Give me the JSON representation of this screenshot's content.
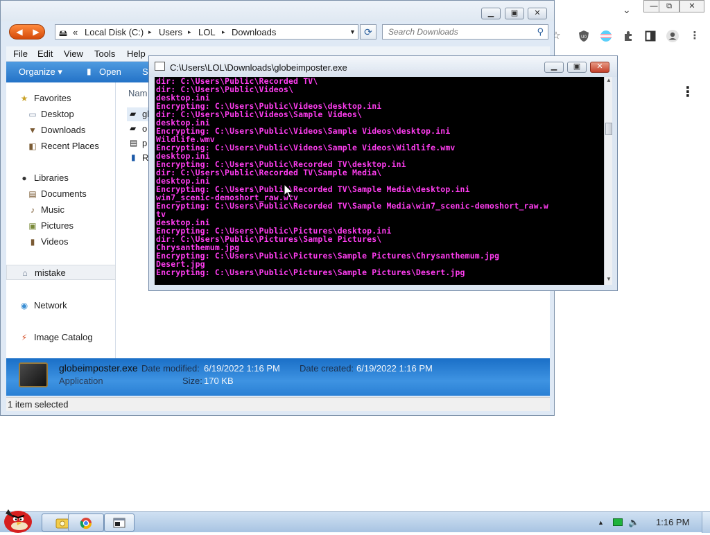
{
  "browser": {
    "chevron": "⌄",
    "minimize": "—",
    "restore": "⧉",
    "close": "✕",
    "toolbar_icons": [
      "star-icon",
      "ublock-icon",
      "flag-icon",
      "extensions-icon",
      "sidepanel-icon",
      "profile-icon",
      "menu-icon"
    ],
    "menu_dots": "⋮"
  },
  "explorer": {
    "address": {
      "chevrons": "«",
      "crumbs": [
        "Local Disk (C:)",
        "Users",
        "LOL",
        "Downloads"
      ],
      "separator": "▸"
    },
    "search_placeholder": "Search Downloads",
    "menu": [
      "File",
      "Edit",
      "View",
      "Tools",
      "Help"
    ],
    "toolbar": {
      "organize": "Organize ▾",
      "open": "Open",
      "share": "S"
    },
    "nav": {
      "favorites": "Favorites",
      "desktop": "Desktop",
      "downloads": "Downloads",
      "recent": "Recent Places",
      "libraries": "Libraries",
      "documents": "Documents",
      "music": "Music",
      "pictures": "Pictures",
      "videos": "Videos",
      "mistake": "mistake",
      "network": "Network",
      "image_catalog": "Image Catalog"
    },
    "file_header": "Nam",
    "file_rows": [
      "gl",
      "o",
      "p",
      "R"
    ],
    "details": {
      "name": "globeimposter.exe",
      "type": "Application",
      "date_modified_label": "Date modified:",
      "date_modified": "6/19/2022 1:16 PM",
      "date_created_label": "Date created:",
      "date_created": "6/19/2022 1:16 PM",
      "size_label": "Size:",
      "size": "170 KB"
    },
    "status": "1 item selected"
  },
  "console": {
    "title": "C:\\Users\\LOL\\Downloads\\globeimposter.exe",
    "text_color": "#ff3df0",
    "lines": [
      "dir: C:\\Users\\Public\\Recorded TV\\",
      "dir: C:\\Users\\Public\\Videos\\",
      "desktop.ini",
      "Encrypting: C:\\Users\\Public\\Videos\\desktop.ini",
      "dir: C:\\Users\\Public\\Videos\\Sample Videos\\",
      "desktop.ini",
      "Encrypting: C:\\Users\\Public\\Videos\\Sample Videos\\desktop.ini",
      "Wildlife.wmv",
      "Encrypting: C:\\Users\\Public\\Videos\\Sample Videos\\Wildlife.wmv",
      "desktop.ini",
      "Encrypting: C:\\Users\\Public\\Recorded TV\\desktop.ini",
      "dir: C:\\Users\\Public\\Recorded TV\\Sample Media\\",
      "desktop.ini",
      "Encrypting: C:\\Users\\Public\\Recorded TV\\Sample Media\\desktop.ini",
      "win7_scenic-demoshort_raw.wtv",
      "Encrypting: C:\\Users\\Public\\Recorded TV\\Sample Media\\win7_scenic-demoshort_raw.w",
      "tv",
      "desktop.ini",
      "Encrypting: C:\\Users\\Public\\Pictures\\desktop.ini",
      "dir: C:\\Users\\Public\\Pictures\\Sample Pictures\\",
      "Chrysanthemum.jpg",
      "Encrypting: C:\\Users\\Public\\Pictures\\Sample Pictures\\Chrysanthemum.jpg",
      "Desert.jpg",
      "Encrypting: C:\\Users\\Public\\Pictures\\Sample Pictures\\Desert.jpg"
    ]
  },
  "taskbar": {
    "time": "1:16 PM",
    "tray_arrow": "▲"
  }
}
